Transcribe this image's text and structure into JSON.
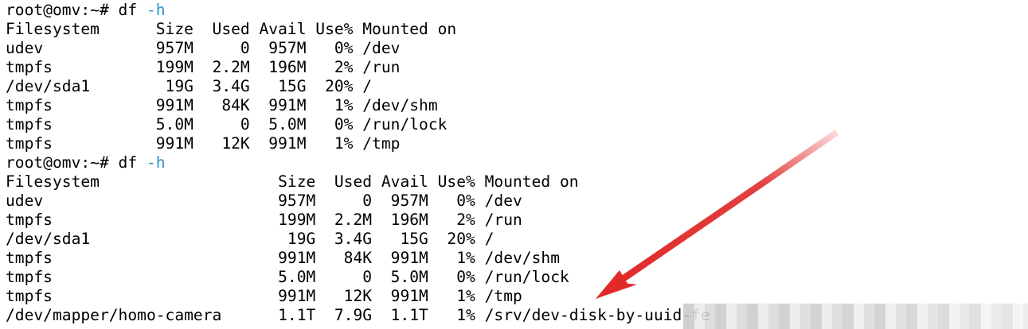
{
  "terminal": {
    "lines": [
      {
        "text": "root@omv:~# df ",
        "flag": "-h"
      },
      {
        "text": "Filesystem      Size  Used Avail Use% Mounted on"
      },
      {
        "text": "udev            957M     0  957M   0% /dev"
      },
      {
        "text": "tmpfs           199M  2.2M  196M   2% /run"
      },
      {
        "text": "/dev/sda1        19G  3.4G   15G  20% /"
      },
      {
        "text": "tmpfs           991M   84K  991M   1% /dev/shm"
      },
      {
        "text": "tmpfs           5.0M     0  5.0M   0% /run/lock"
      },
      {
        "text": "tmpfs           991M   12K  991M   1% /tmp"
      },
      {
        "text": "root@omv:~# df ",
        "flag": "-h"
      },
      {
        "text": "Filesystem                   Size  Used Avail Use% Mounted on"
      },
      {
        "text": "udev                         957M     0  957M   0% /dev"
      },
      {
        "text": "tmpfs                        199M  2.2M  196M   2% /run"
      },
      {
        "text": "/dev/sda1                     19G  3.4G   15G  20% /"
      },
      {
        "text": "tmpfs                        991M   84K  991M   1% /dev/shm"
      },
      {
        "text": "tmpfs                        5.0M     0  5.0M   0% /run/lock"
      },
      {
        "text": "tmpfs                        991M   12K  991M   1% /tmp"
      },
      {
        "text": "/dev/mapper/homo-camera      1.1T  7.9G  1.1T   1% /srv/dev-disk-by-uuid-fe"
      }
    ]
  },
  "colors": {
    "background": "#ffffff",
    "text": "#000000",
    "flag": "#2a8fc9",
    "arrow": "#e02a2a"
  },
  "annotations": {
    "arrow_icon": "red-arrow-icon",
    "redaction": "pixelated-redaction"
  }
}
